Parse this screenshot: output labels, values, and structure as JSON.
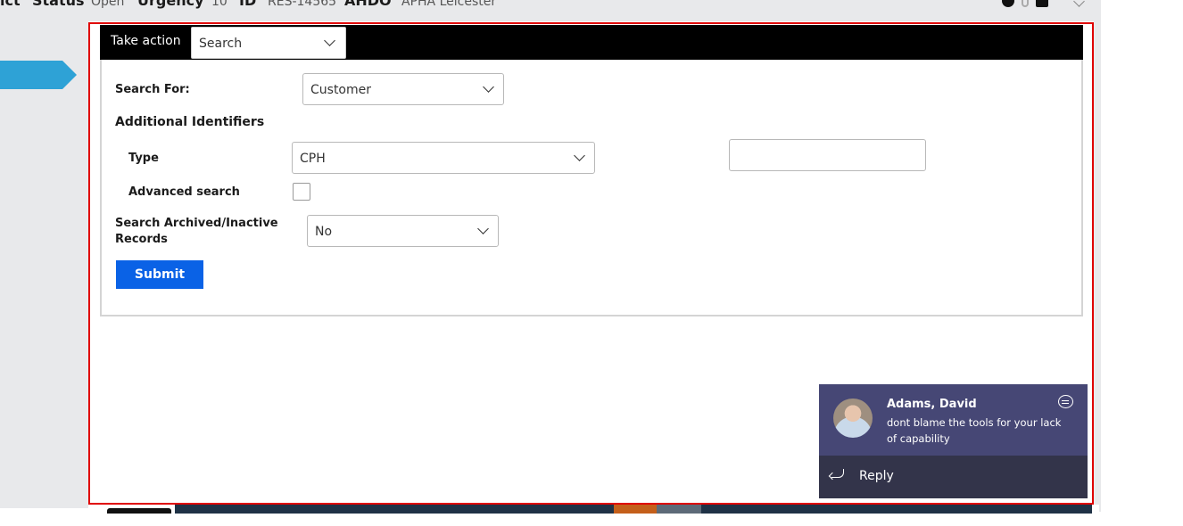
{
  "header": {
    "fields": [
      {
        "label": "ict",
        "value": ""
      },
      {
        "label": "Status",
        "value": "Open"
      },
      {
        "label": "Urgency",
        "value": "10"
      },
      {
        "label": "ID",
        "value": "RES-14565"
      },
      {
        "label": "AHDO",
        "value": "APHA Leicester"
      }
    ]
  },
  "action_bar": {
    "label": "Take action",
    "select_value": "Search"
  },
  "form": {
    "search_for": {
      "label": "Search For:",
      "value": "Customer"
    },
    "additional_identifiers_title": "Additional Identifiers",
    "type": {
      "label": "Type",
      "value": "CPH"
    },
    "identifier_value": "",
    "advanced_search": {
      "label": "Advanced search",
      "checked": false
    },
    "archived": {
      "label_line1": "Search Archived/Inactive",
      "label_line2": "Records",
      "value": "No"
    },
    "submit_label": "Submit"
  },
  "toast": {
    "sender": "Adams, David",
    "message": "dont blame the tools for your lack of capability",
    "reply_label": "Reply"
  },
  "colors": {
    "highlight_border": "#e00000",
    "action_bar_bg": "#000000",
    "submit_bg": "#0a62e6",
    "toast_bg": "#464775",
    "toast_reply_bg": "#33344a",
    "nav_arrow": "#2ea2d6"
  }
}
